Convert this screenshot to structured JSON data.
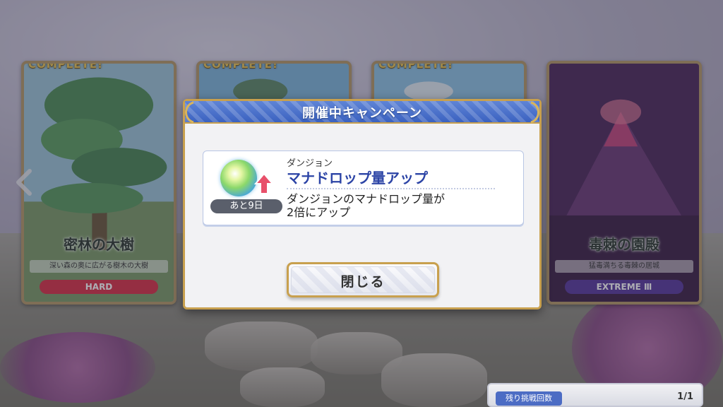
{
  "cards": [
    {
      "complete_label": "COMPLETE!",
      "title": "密林の大樹",
      "subtitle": "深い森の奥に広がる樹木の大樹",
      "difficulty": "HARD",
      "difficulty_color": "#d9324a"
    },
    {
      "complete_label": "COMPLETE!"
    },
    {
      "complete_label": "COMPLETE!"
    },
    {
      "title": "毒棘の園殿",
      "subtitle": "猛毒満ちる毒棘の居城",
      "difficulty": "EXTREME Ⅲ",
      "difficulty_color": "#5a3a9e"
    }
  ],
  "modal": {
    "title": "開催中キャンペーン",
    "campaign": {
      "kind": "ダンジョン",
      "name": "マナドロップ量アップ",
      "description_line1": "ダンジョンのマナドロップ量が",
      "description_line2": "2倍にアップ",
      "remaining": "あと9日"
    },
    "close_label": "閉じる"
  },
  "remaining_attempts": {
    "label": "残り挑戦回数",
    "value": "1/1"
  },
  "colors": {
    "header_blue": "#3b62c0",
    "gold_border": "#c8a04e",
    "campaign_name": "#2c44a6"
  }
}
